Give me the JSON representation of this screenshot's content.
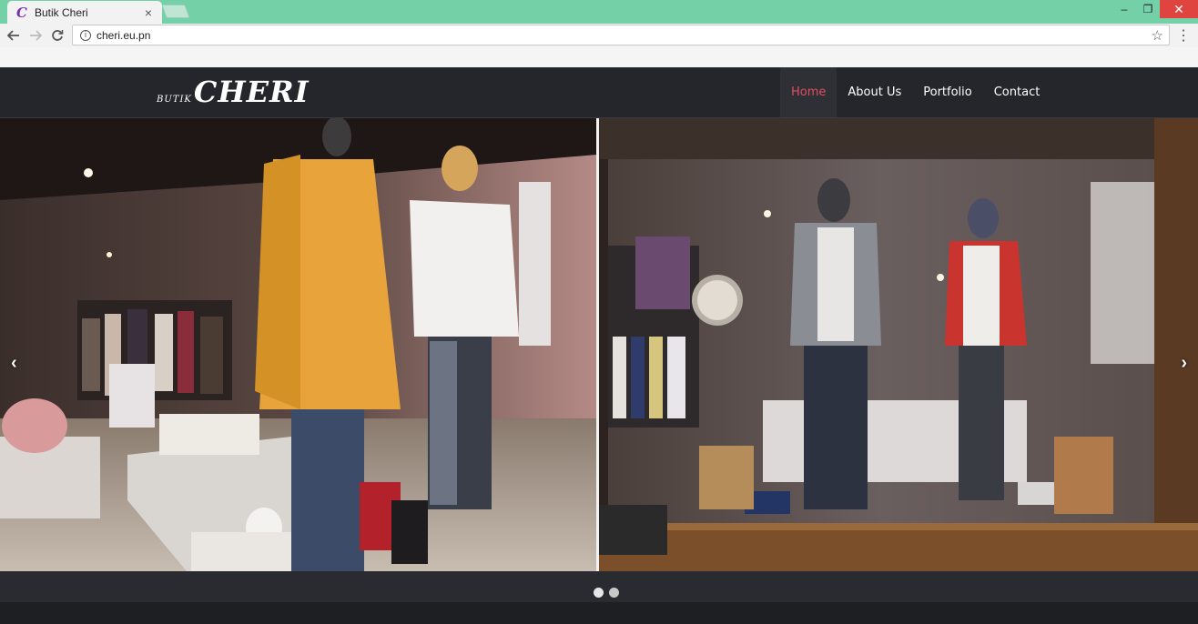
{
  "browser": {
    "tab_title": "Butik Cheri",
    "tab_close": "×",
    "url": "cheri.eu.pn",
    "favicon_glyph": "C",
    "win_minimize": "–",
    "win_maximize": "❐",
    "win_close": "✕"
  },
  "site": {
    "logo_small": "BUTIK",
    "logo_big": "CHERI",
    "nav": [
      {
        "label": "Home",
        "active": true
      },
      {
        "label": "About Us"
      },
      {
        "label": "Portfolio"
      },
      {
        "label": "Contact"
      }
    ]
  },
  "carousel": {
    "prev": "‹",
    "next": "›",
    "slide_count": 2,
    "active_slide": 1
  },
  "colors": {
    "titlebar": "#74d0a7",
    "header_bg": "#25262b",
    "nav_active": "#e24b63",
    "close_button": "#e0443e"
  }
}
